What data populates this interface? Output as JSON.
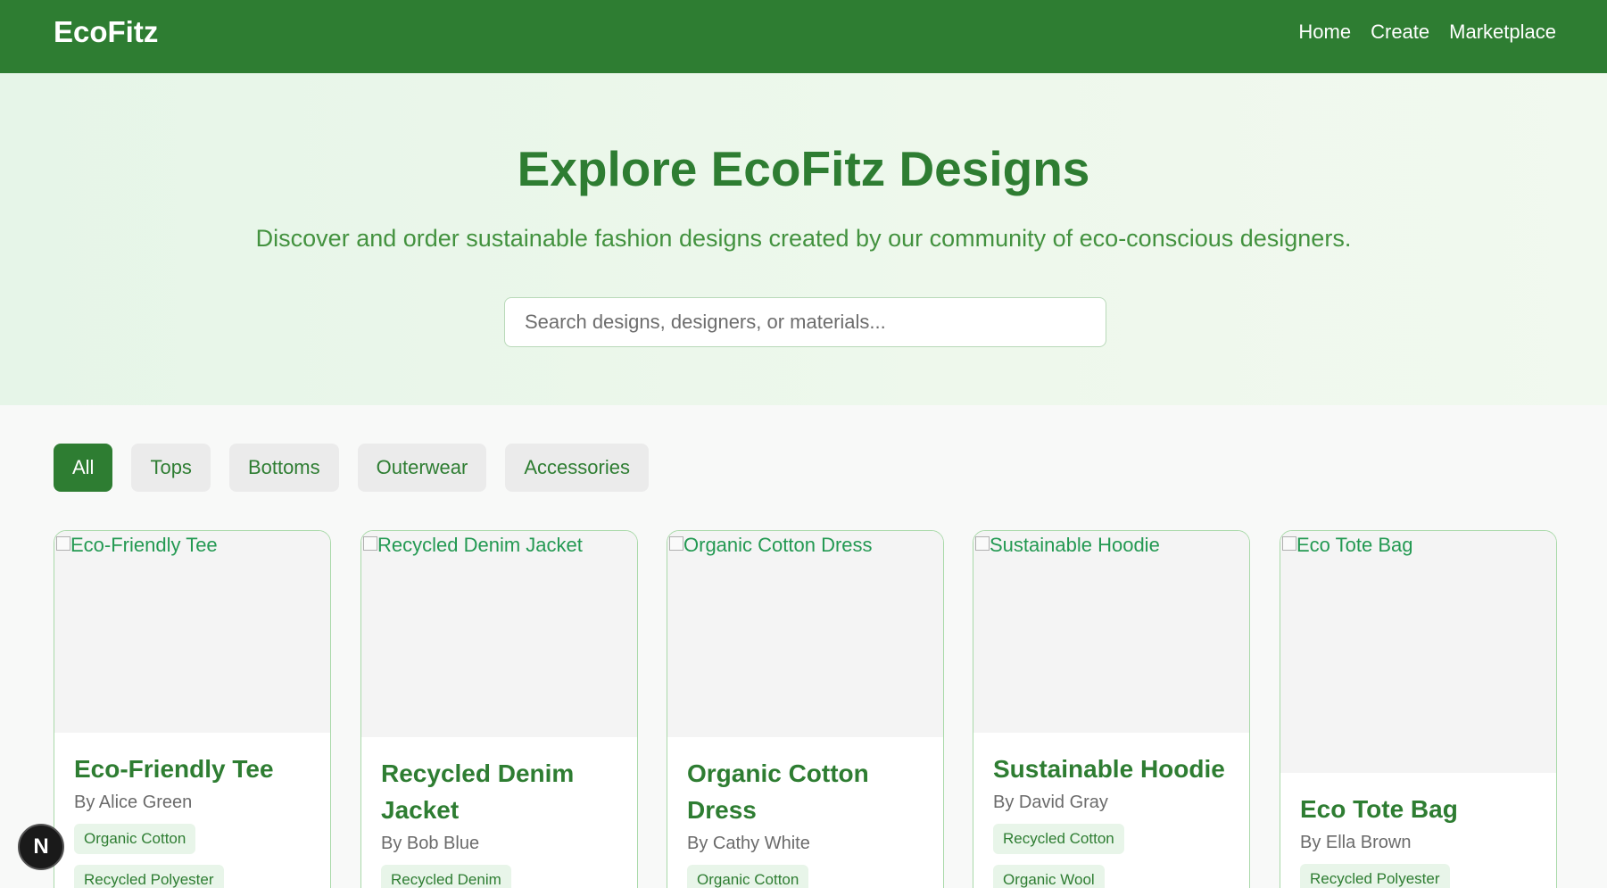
{
  "nav": {
    "brand": "EcoFitz",
    "links": [
      "Home",
      "Create",
      "Marketplace"
    ]
  },
  "hero": {
    "title": "Explore EcoFitz Designs",
    "subtitle": "Discover and order sustainable fashion designs created by our community of eco-conscious designers.",
    "search_placeholder": "Search designs, designers, or materials..."
  },
  "filters": [
    "All",
    "Tops",
    "Bottoms",
    "Outerwear",
    "Accessories"
  ],
  "active_filter": "All",
  "cards": [
    {
      "image_alt": "Eco-Friendly Tee",
      "title": "Eco-Friendly Tee",
      "designer": "By Alice Green",
      "materials": [
        "Organic Cotton",
        "Recycled Polyester"
      ]
    },
    {
      "image_alt": "Recycled Denim Jacket",
      "title": "Recycled Denim Jacket",
      "designer": "By Bob Blue",
      "materials": [
        "Recycled Denim"
      ]
    },
    {
      "image_alt": "Organic Cotton Dress",
      "title": "Organic Cotton Dress",
      "designer": "By Cathy White",
      "materials": [
        "Organic Cotton"
      ]
    },
    {
      "image_alt": "Sustainable Hoodie",
      "title": "Sustainable Hoodie",
      "designer": "By David Gray",
      "materials": [
        "Recycled Cotton",
        "Organic Wool"
      ]
    },
    {
      "image_alt": "Eco Tote Bag",
      "title": "Eco Tote Bag",
      "designer": "By Ella Brown",
      "materials": [
        "Recycled Polyester"
      ]
    }
  ],
  "dev_badge": "N",
  "colors": {
    "primary": "#2e7d32",
    "accent_text": "#239952",
    "tag_bg": "#e8f5e9",
    "card_border": "#a9d9a9"
  }
}
